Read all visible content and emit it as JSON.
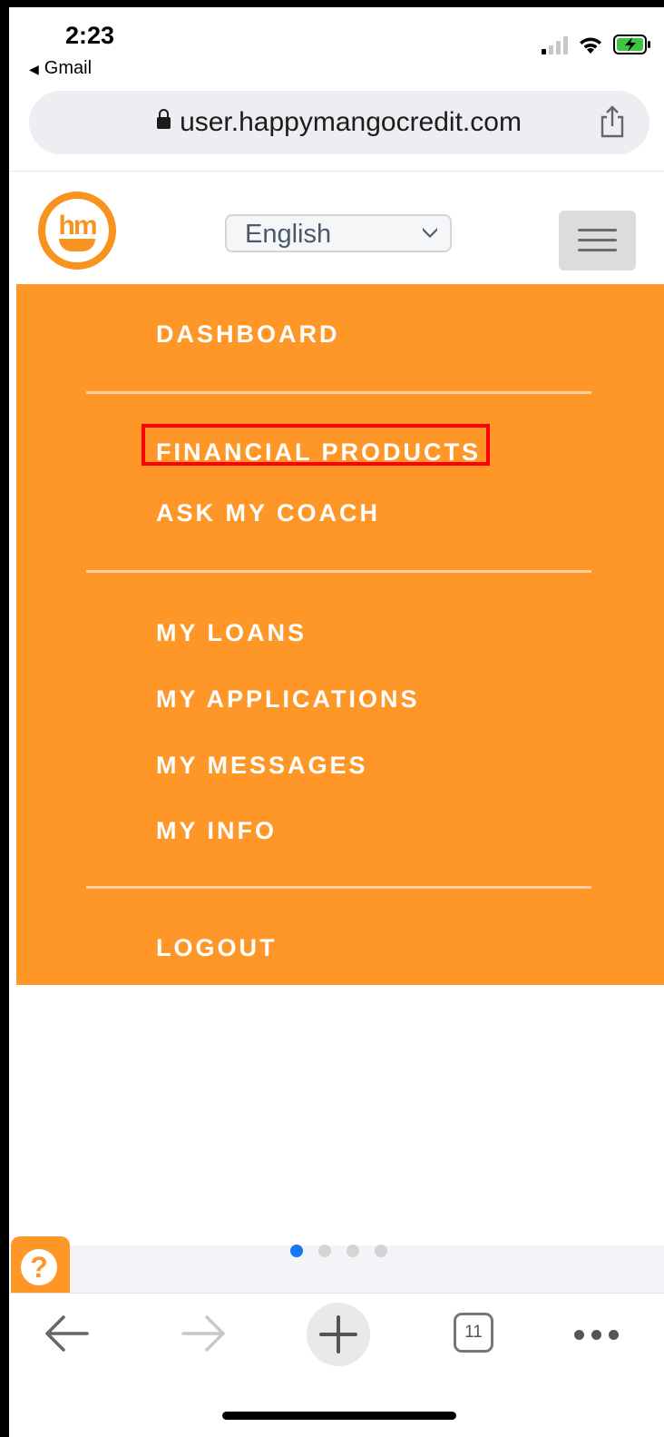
{
  "status_bar": {
    "time": "2:23",
    "back_app": "Gmail",
    "back_glyph": "◀"
  },
  "browser": {
    "url": "user.happymangocredit.com"
  },
  "site_header": {
    "logo_text": "hm",
    "language": "English"
  },
  "menu": {
    "items": [
      {
        "label": "DASHBOARD"
      },
      {
        "label": "FINANCIAL PRODUCTS",
        "highlighted": true
      },
      {
        "label": "ASK MY COACH"
      },
      {
        "label": "MY LOANS"
      },
      {
        "label": "MY APPLICATIONS"
      },
      {
        "label": "MY MESSAGES"
      },
      {
        "label": "MY INFO"
      },
      {
        "label": "LOGOUT"
      }
    ],
    "background_color": "#fe9628",
    "highlight_color": "#ff0000"
  },
  "help_button": {
    "icon": "question-icon",
    "glyph": "?"
  },
  "carousel": {
    "page_count": 4,
    "active_index": 0
  },
  "toolbar": {
    "tab_count": "11",
    "icons": [
      "back-arrow-icon",
      "forward-arrow-icon",
      "plus-icon",
      "tabs-icon",
      "more-icon"
    ]
  }
}
